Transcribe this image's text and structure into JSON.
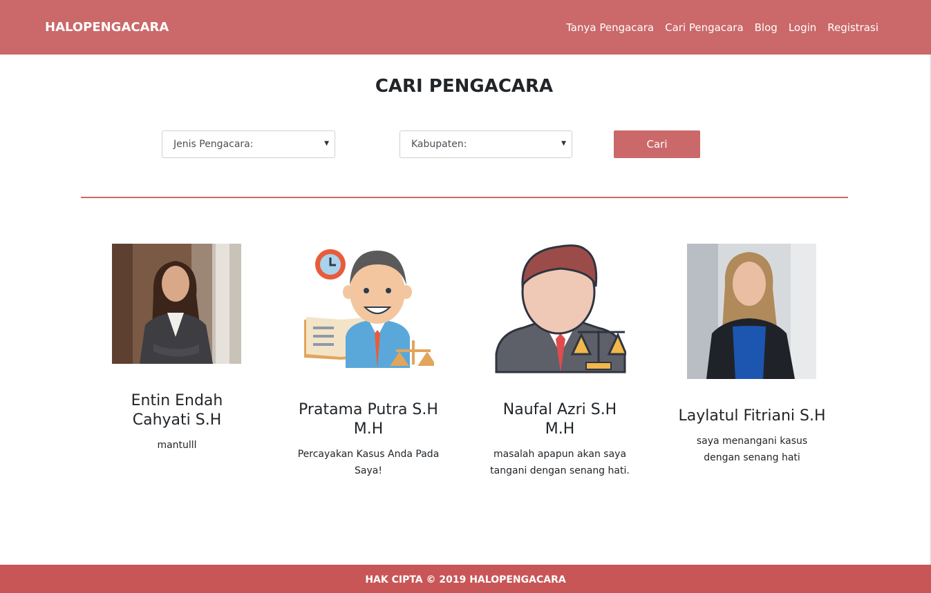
{
  "brand": "HALOPENGACARA",
  "nav": {
    "items": [
      "Tanya Pengacara",
      "Cari Pengacara",
      "Blog",
      "Login",
      "Registrasi"
    ]
  },
  "page_title": "CARI PENGACARA",
  "search": {
    "jenis_placeholder": "Jenis Pengacara:",
    "kabupaten_placeholder": "Kabupaten:",
    "button_label": "Cari"
  },
  "lawyers": [
    {
      "name_line1": "Entin Endah",
      "name_line2": "Cahyati S.H",
      "desc_line1": "mantulll",
      "desc_line2": "",
      "photo": "woman-photo"
    },
    {
      "name_line1": "Pratama Putra S.H",
      "name_line2": "M.H",
      "desc_line1": "Percayakan Kasus Anda Pada",
      "desc_line2": "Saya!",
      "photo": "lawyer-illustration"
    },
    {
      "name_line1": "Naufal Azri S.H",
      "name_line2": "M.H",
      "desc_line1": "masalah apapun akan saya",
      "desc_line2": "tangani dengan senang hati.",
      "photo": "lawyer-avatar"
    },
    {
      "name_line1": "Laylatul Fitriani S.H",
      "name_line2": "",
      "desc_line1": "saya menangani kasus",
      "desc_line2": "dengan senang hati",
      "photo": "woman-photo"
    }
  ],
  "footer": "HAK CIPTA © 2019 HALOPENGACARA",
  "colors": {
    "primary": "#cb6869",
    "footer": "#c95657"
  }
}
